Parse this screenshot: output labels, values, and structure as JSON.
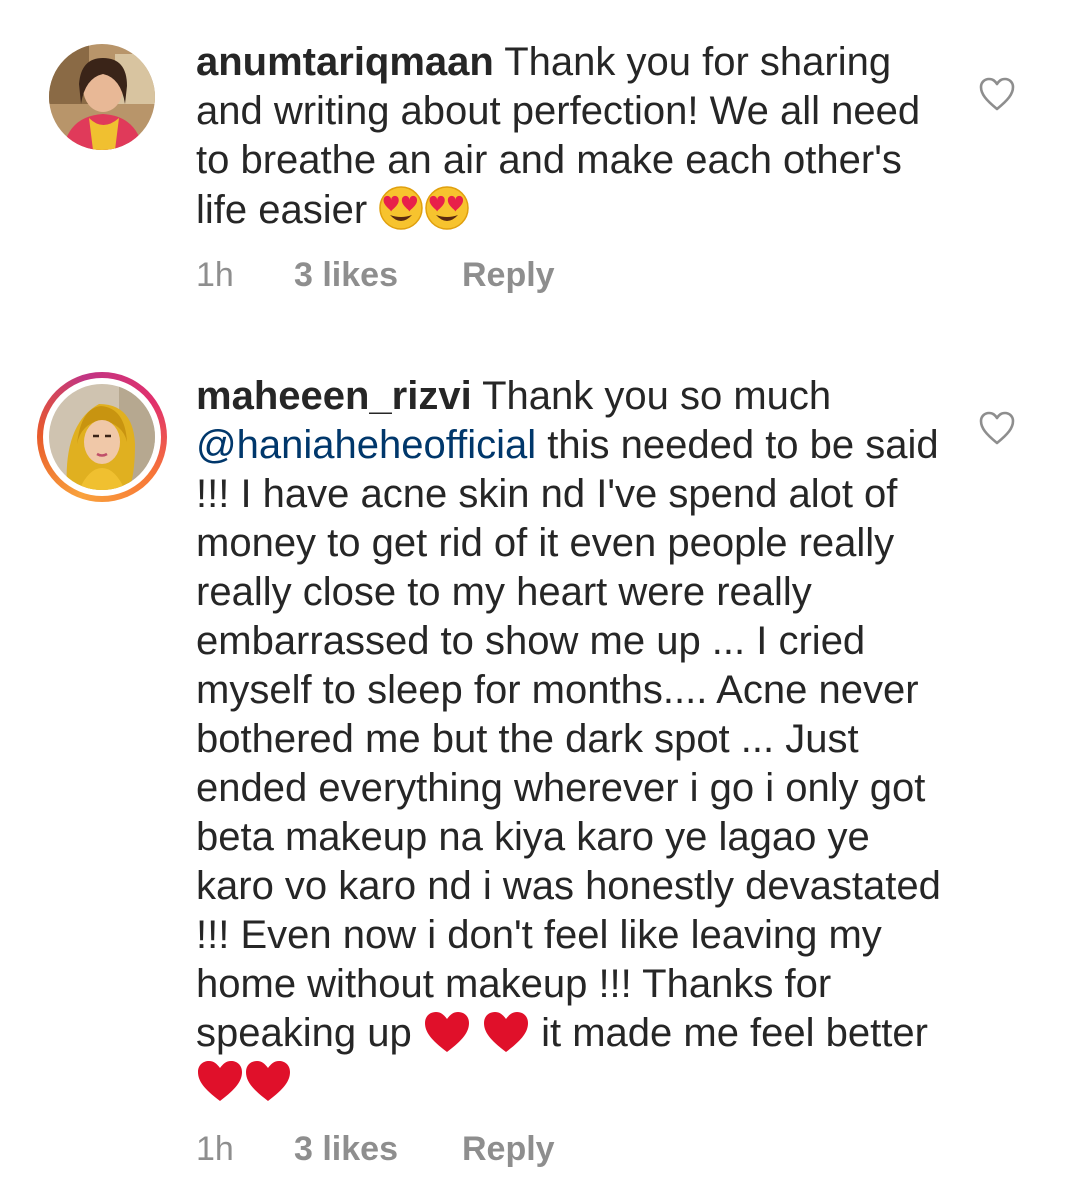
{
  "comments": [
    {
      "username": "anumtariqmaan",
      "text": " Thank you for sharing and writing about perfection! We all need to breathe an air and make each other's life easier ",
      "time": "1h",
      "likes": "3 likes",
      "reply": "Reply",
      "has_story_ring": false
    },
    {
      "username": "maheeen_rizvi",
      "text_before_mention": " Thank you so much ",
      "mention": "@haniaheheofficial",
      "text_after_mention": " this needed to be said !!! I have acne skin nd I've spend alot of money to get rid of it even people really really close to my heart were really embarrassed to show me up ... I cried myself to sleep for months.... Acne never bothered me but the dark spot ... Just ended everything wherever i go i only got beta makeup na kiya karo ye lagao ye karo vo karo nd i was honestly devastated !!! Even now i don't feel like leaving my home without makeup !!! Thanks for speaking up ",
      "text_end": " it made me feel better ",
      "time": "1h",
      "likes": "3 likes",
      "reply": "Reply",
      "has_story_ring": true
    }
  ],
  "icons": {
    "emoji": "heart-eyes-emoji-icon",
    "red_heart": "red-heart-emoji-icon",
    "like": "heart-outline-icon"
  },
  "colors": {
    "mention": "#00376b",
    "meta": "#8e8e8e",
    "heart": "#e0102a"
  }
}
